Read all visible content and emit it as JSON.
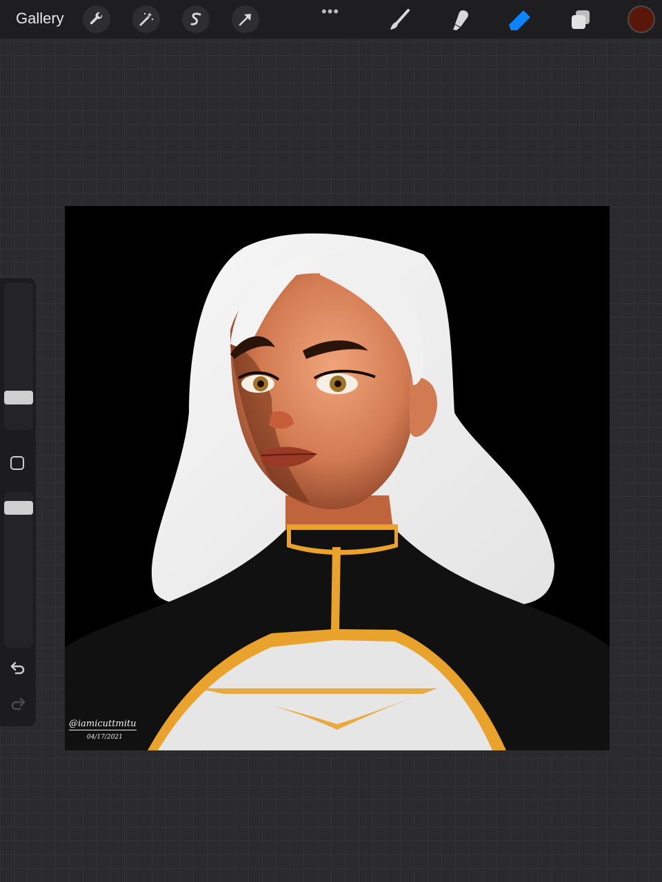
{
  "topbar": {
    "gallery_label": "Gallery",
    "more_dots": "•••",
    "left_tools": [
      {
        "name": "actions",
        "icon": "wrench-icon"
      },
      {
        "name": "adjustments",
        "icon": "magic-wand-icon"
      },
      {
        "name": "selection",
        "icon": "selection-s-icon"
      },
      {
        "name": "transform",
        "icon": "arrow-cursor-icon"
      }
    ],
    "right_tools": [
      {
        "name": "brush",
        "icon": "brush-icon"
      },
      {
        "name": "smudge",
        "icon": "smudge-icon"
      },
      {
        "name": "eraser",
        "icon": "eraser-icon",
        "active": true
      },
      {
        "name": "layers",
        "icon": "layers-icon"
      }
    ],
    "active_color": "#5a1608",
    "accent_color": "#0a84ff"
  },
  "sidebar": {
    "brush_size": 0.45,
    "opacity": 0.8,
    "undo_icon": "undo-arrow-icon",
    "redo_icon": "redo-arrow-icon"
  },
  "artwork": {
    "signature": "@iamicuttmitu",
    "date": "04/17/2021"
  }
}
